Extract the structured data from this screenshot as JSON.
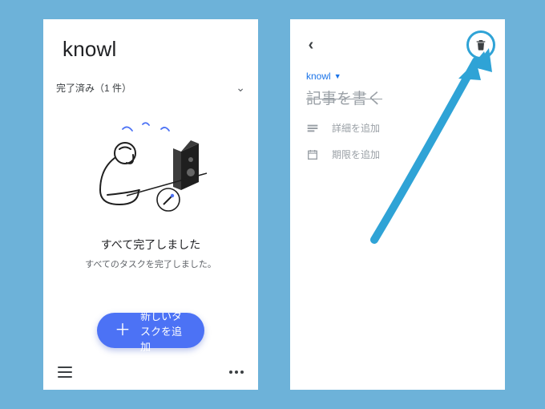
{
  "colors": {
    "page_bg": "#6db2d9",
    "primary": "#4c72f5",
    "accent_blue": "#1a73e8",
    "highlight_ring": "#2fa3d6",
    "text": "#202124",
    "text_muted": "#5f6368",
    "text_disabled": "#9aa0a6"
  },
  "left": {
    "app_title": "knowl",
    "completed_header": "完了済み（1 件）",
    "empty_title": "すべて完了しました",
    "empty_sub": "すべてのタスクを完了しました。",
    "fab_label": "新しいタスクを追加"
  },
  "right": {
    "list_name": "knowl",
    "task_title": "記事を書く",
    "add_details": "詳細を追加",
    "add_date": "期限を追加"
  }
}
